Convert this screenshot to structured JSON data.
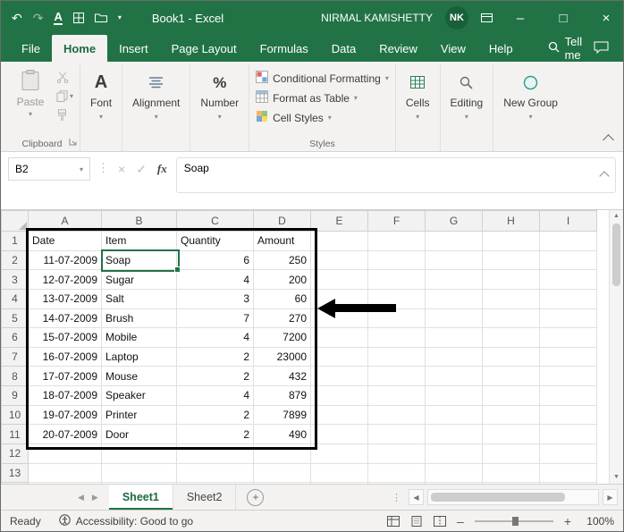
{
  "titlebar": {
    "title": "Book1 - Excel",
    "user": "NIRMAL KAMISHETTY",
    "user_initials": "NK"
  },
  "tabs": {
    "items": [
      "File",
      "Home",
      "Insert",
      "Page Layout",
      "Formulas",
      "Data",
      "Review",
      "View",
      "Help"
    ],
    "active": "Home",
    "tell_me": "Tell me"
  },
  "ribbon": {
    "clipboard": {
      "paste": "Paste",
      "label": "Clipboard"
    },
    "font": {
      "label": "Font"
    },
    "alignment": {
      "label": "Alignment"
    },
    "number": {
      "label": "Number"
    },
    "styles": {
      "conditional_formatting": "Conditional Formatting",
      "format_as_table": "Format as Table",
      "cell_styles": "Cell Styles",
      "label": "Styles"
    },
    "cells": {
      "label": "Cells"
    },
    "editing": {
      "label": "Editing"
    },
    "new_group": {
      "label": "New Group"
    }
  },
  "formula_bar": {
    "name_box": "B2",
    "fx_label": "fx",
    "formula": "Soap"
  },
  "grid": {
    "columns": [
      "A",
      "B",
      "C",
      "D",
      "E",
      "F",
      "G",
      "H",
      "I"
    ],
    "row_count": 14,
    "selected_cell": "B2",
    "bordered_range": "A1:D11",
    "cells": [
      {
        "row": 1,
        "values": {
          "A": "Date",
          "B": "Item",
          "C": "Quantity",
          "D": "Amount"
        }
      },
      {
        "row": 2,
        "values": {
          "A": "11-07-2009",
          "B": "Soap",
          "C": "6",
          "D": "250"
        }
      },
      {
        "row": 3,
        "values": {
          "A": "12-07-2009",
          "B": "Sugar",
          "C": "4",
          "D": "200"
        }
      },
      {
        "row": 4,
        "values": {
          "A": "13-07-2009",
          "B": "Salt",
          "C": "3",
          "D": "60"
        }
      },
      {
        "row": 5,
        "values": {
          "A": "14-07-2009",
          "B": "Brush",
          "C": "7",
          "D": "270"
        }
      },
      {
        "row": 6,
        "values": {
          "A": "15-07-2009",
          "B": "Mobile",
          "C": "4",
          "D": "7200"
        }
      },
      {
        "row": 7,
        "values": {
          "A": "16-07-2009",
          "B": "Laptop",
          "C": "2",
          "D": "23000"
        }
      },
      {
        "row": 8,
        "values": {
          "A": "17-07-2009",
          "B": "Mouse",
          "C": "2",
          "D": "432"
        }
      },
      {
        "row": 9,
        "values": {
          "A": "18-07-2009",
          "B": "Speaker",
          "C": "4",
          "D": "879"
        }
      },
      {
        "row": 10,
        "values": {
          "A": "19-07-2009",
          "B": "Printer",
          "C": "2",
          "D": "7899"
        }
      },
      {
        "row": 11,
        "values": {
          "A": "20-07-2009",
          "B": "Door",
          "C": "2",
          "D": "490"
        }
      }
    ],
    "annotation": {
      "shape": "arrow",
      "direction": "left",
      "points_at": "D4"
    }
  },
  "sheet_bar": {
    "sheets": [
      "Sheet1",
      "Sheet2"
    ],
    "active_sheet": "Sheet1"
  },
  "status_bar": {
    "mode": "Ready",
    "accessibility": "Accessibility: Good to go",
    "zoom": "100%"
  },
  "colors": {
    "excel_green": "#217346",
    "range_border": "#000000"
  }
}
